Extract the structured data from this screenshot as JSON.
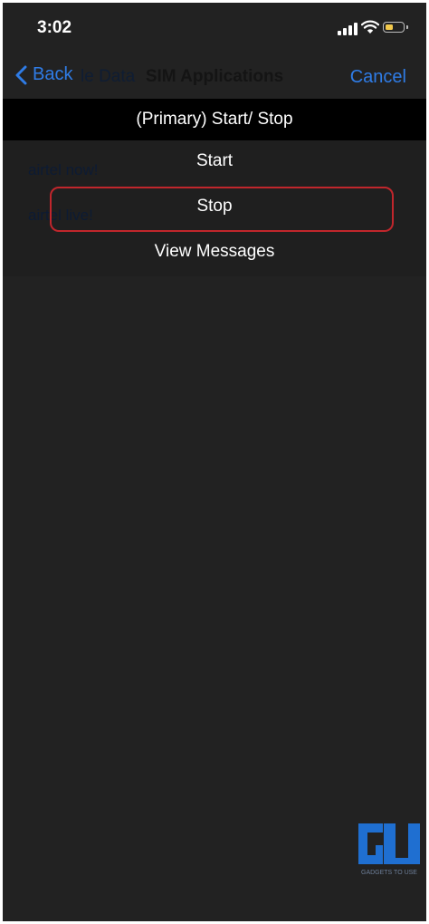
{
  "status_bar": {
    "time": "3:02"
  },
  "nav": {
    "back_label": "Back",
    "ghost_label": "le Data",
    "title": "SIM Applications",
    "cancel_label": "Cancel"
  },
  "underlying_list": [
    "airtel now!",
    "airtel live!"
  ],
  "action_sheet": {
    "title": "(Primary) Start/ Stop",
    "options": [
      "Start",
      "Stop",
      "View Messages"
    ],
    "highlighted_option": "Stop"
  },
  "watermark": {
    "tagline": "GADGETS TO USE"
  },
  "colors": {
    "accent": "#2f7ce6",
    "background": "#222222",
    "sheet_header": "#000000",
    "highlight_border": "#c0262c",
    "battery_fill": "#f2c94c"
  }
}
